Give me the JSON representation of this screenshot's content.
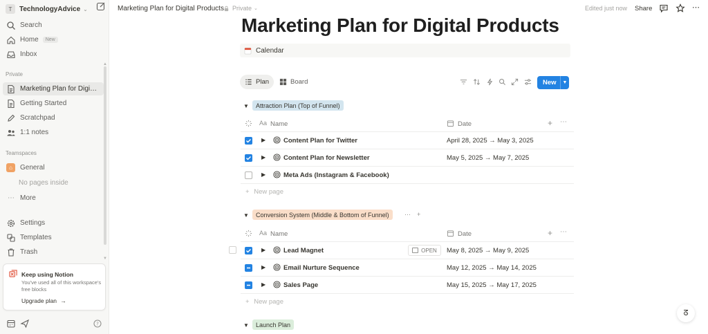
{
  "colors": {
    "accent": "#2383e2",
    "group_attraction": "#d3e5ef",
    "group_conversion": "#fadec9",
    "group_launch": "#dbeddb",
    "workspace_icon": "#f0a264"
  },
  "workspace": {
    "initial": "T",
    "name": "TechnologyAdvice"
  },
  "sidebar": {
    "top_items": [
      {
        "label": "Search",
        "icon": "search-icon"
      },
      {
        "label": "Home",
        "icon": "home-icon",
        "badge": "New"
      },
      {
        "label": "Inbox",
        "icon": "inbox-icon"
      }
    ],
    "private_label": "Private",
    "private_items": [
      {
        "label": "Marketing Plan for Digital Products",
        "icon": "page-icon",
        "active": true
      },
      {
        "label": "Getting Started",
        "icon": "page-icon"
      },
      {
        "label": "Scratchpad",
        "icon": "pencil-icon"
      },
      {
        "label": "1:1 notes",
        "icon": "people-icon"
      }
    ],
    "teamspaces_label": "Teamspaces",
    "teamspace": {
      "label": "General",
      "icon": "home-icon"
    },
    "no_pages": "No pages inside",
    "more": "More",
    "bottom_items": [
      {
        "label": "Settings",
        "icon": "gear-icon"
      },
      {
        "label": "Templates",
        "icon": "templates-icon"
      },
      {
        "label": "Trash",
        "icon": "trash-icon"
      }
    ],
    "upgrade": {
      "title": "Keep using Notion",
      "body": "You've used all of this workspace's free blocks",
      "link": "Upgrade plan",
      "arrow": "→"
    }
  },
  "topbar": {
    "breadcrumb": "Marketing Plan for Digital Products",
    "privacy": "Private",
    "edited": "Edited just now",
    "share": "Share"
  },
  "page": {
    "title": "Marketing Plan for Digital Products",
    "calendar_link": "Calendar"
  },
  "views": {
    "tabs": [
      {
        "label": "Plan",
        "icon": "list-icon",
        "active": true
      },
      {
        "label": "Board",
        "icon": "board-icon"
      }
    ],
    "new_button": "New"
  },
  "columns": {
    "name": "Name",
    "date": "Date",
    "name_prefix": "Aa"
  },
  "new_page": "New page",
  "groups": [
    {
      "title": "Attraction Plan (Top of Funnel)",
      "rows": [
        {
          "name": "Content Plan for Twitter",
          "date": "April 28, 2025 → May 3, 2025",
          "status": "checked"
        },
        {
          "name": "Content Plan for Newsletter",
          "date": "May 5, 2025 → May 7, 2025",
          "status": "checked"
        },
        {
          "name": "Meta Ads (Instagram & Facebook)",
          "date": "",
          "status": "empty"
        }
      ]
    },
    {
      "title": "Conversion System (Middle & Bottom of Funnel)",
      "rows": [
        {
          "name": "Lead Magnet",
          "date": "May 8, 2025 → May 9, 2025",
          "status": "checked",
          "open_label": "OPEN"
        },
        {
          "name": "Email Nurture Sequence",
          "date": "May 12, 2025 → May 14, 2025",
          "status": "partial"
        },
        {
          "name": "Sales Page",
          "date": "May 15, 2025 → May 17, 2025",
          "status": "partial"
        }
      ]
    },
    {
      "title": "Launch Plan",
      "rows": []
    }
  ]
}
